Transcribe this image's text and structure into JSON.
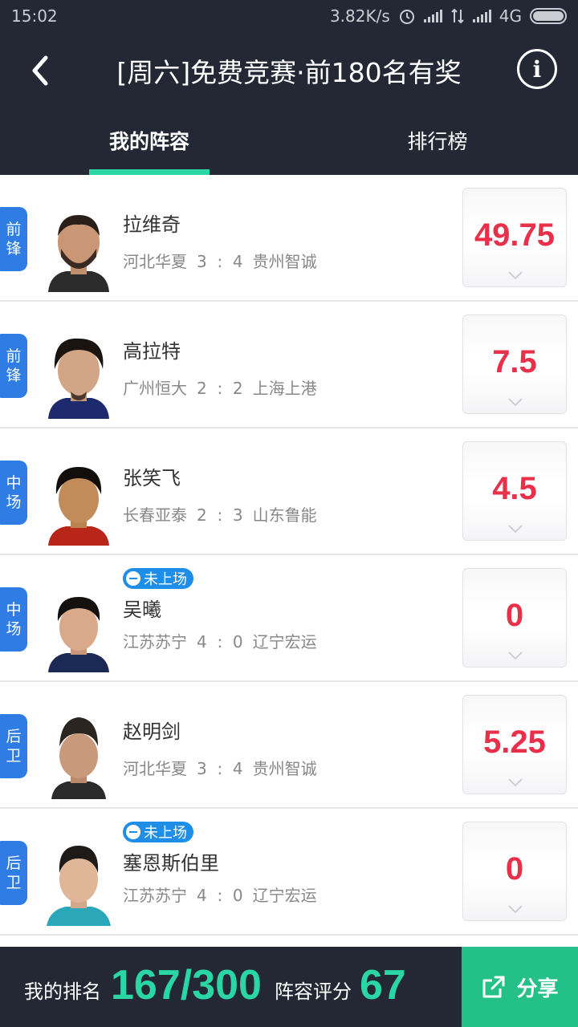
{
  "status_bar": {
    "time": "15:02",
    "net_speed": "3.82K/s",
    "network": "4G"
  },
  "navbar": {
    "title": "[周六]免费竞赛·前180名有奖"
  },
  "tabs": [
    {
      "label": "我的阵容"
    },
    {
      "label": "排行榜"
    }
  ],
  "players": [
    {
      "pos1": "前",
      "pos2": "锋",
      "name": "拉维奇",
      "status": "",
      "home": "河北华夏",
      "home_score": "3",
      "sep": ":",
      "away_score": "4",
      "away": "贵州智诚",
      "points": "49.75"
    },
    {
      "pos1": "前",
      "pos2": "锋",
      "name": "高拉特",
      "status": "",
      "home": "广州恒大",
      "home_score": "2",
      "sep": ":",
      "away_score": "2",
      "away": "上海上港",
      "points": "7.5"
    },
    {
      "pos1": "中",
      "pos2": "场",
      "name": "张笑飞",
      "status": "",
      "home": "长春亚泰",
      "home_score": "2",
      "sep": ":",
      "away_score": "3",
      "away": "山东鲁能",
      "points": "4.5"
    },
    {
      "pos1": "中",
      "pos2": "场",
      "name": "吴曦",
      "status": "未上场",
      "home": "江苏苏宁",
      "home_score": "4",
      "sep": ":",
      "away_score": "0",
      "away": "辽宁宏运",
      "points": "0"
    },
    {
      "pos1": "后",
      "pos2": "卫",
      "name": "赵明剑",
      "status": "",
      "home": "河北华夏",
      "home_score": "3",
      "sep": ":",
      "away_score": "4",
      "away": "贵州智诚",
      "points": "5.25"
    },
    {
      "pos1": "后",
      "pos2": "卫",
      "name": "塞恩斯伯里",
      "status": "未上场",
      "home": "江苏苏宁",
      "home_score": "4",
      "sep": ":",
      "away_score": "0",
      "away": "辽宁宏运",
      "points": "0"
    }
  ],
  "footer": {
    "rank_label": "我的排名",
    "rank_value": "167/300",
    "lineup_label": "阵容评分",
    "lineup_value": "67",
    "share_label": "分享"
  },
  "colors": {
    "accent": "#2ad6a3",
    "points": "#e8304a",
    "position_badge": "#2f7de4",
    "header_bg": "#232834",
    "share_bg": "#23c08a"
  }
}
